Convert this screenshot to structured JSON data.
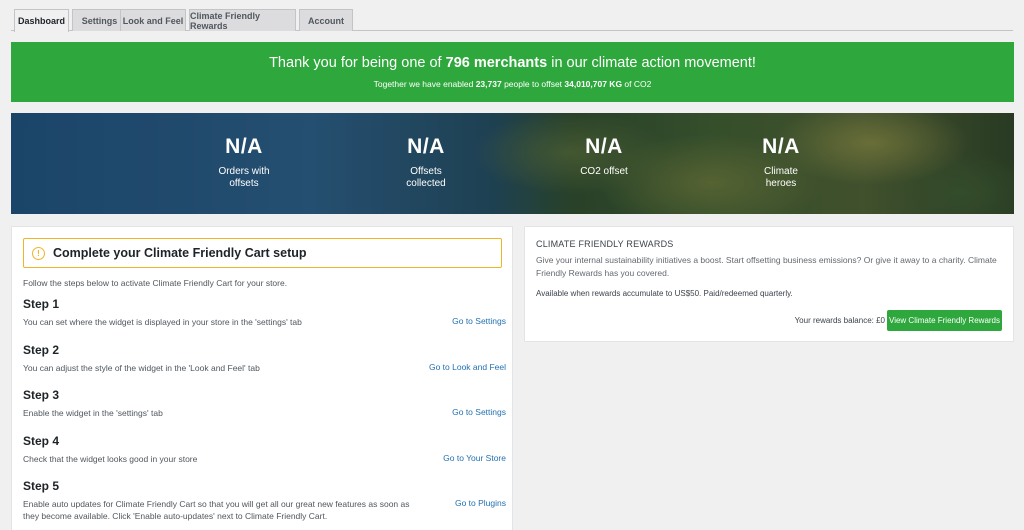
{
  "tabs": [
    {
      "label": "Dashboard",
      "active": true
    },
    {
      "label": "Settings"
    },
    {
      "label": "Look and Feel"
    },
    {
      "label": "Climate Friendly Rewards"
    },
    {
      "label": "Account"
    }
  ],
  "banner": {
    "prefix": "Thank you for being one of ",
    "count": "796 merchants",
    "suffix": " in our climate action movement!",
    "sub_prefix": "Together we have enabled ",
    "people": "23,737",
    "sub_mid": " people to offset ",
    "kg": "34,010,707 KG",
    "sub_suffix": " of CO2",
    "color": "#2ea83c"
  },
  "stats": [
    {
      "value": "N/A",
      "label_line1": "Orders with",
      "label_line2": "offsets"
    },
    {
      "value": "N/A",
      "label_line1": "Offsets",
      "label_line2": "collected"
    },
    {
      "value": "N/A",
      "label_line1": "CO2 offset",
      "label_line2": ""
    },
    {
      "value": "N/A",
      "label_line1": "Climate",
      "label_line2": "heroes"
    }
  ],
  "setup": {
    "title": "Complete your Climate Friendly Cart setup",
    "intro": "Follow the steps below to activate Climate Friendly Cart for your store.",
    "steps": [
      {
        "title": "Step 1",
        "desc": "You can set where the widget is displayed in your store in the 'settings' tab",
        "link": "Go to Settings"
      },
      {
        "title": "Step 2",
        "desc": "You can adjust the style of the widget in the 'Look and Feel' tab",
        "link": "Go to Look and Feel"
      },
      {
        "title": "Step 3",
        "desc": "Enable the widget in the 'settings' tab",
        "link": "Go to Settings"
      },
      {
        "title": "Step 4",
        "desc": "Check that the widget looks good in your store",
        "link": "Go to Your Store"
      },
      {
        "title": "Step 5",
        "desc": "Enable auto updates for Climate Friendly Cart so that you will get all our great new features as soon as they become available. Click 'Enable auto-updates' next to Climate Friendly Cart.",
        "link": "Go to Plugins"
      }
    ]
  },
  "rewards": {
    "title": "CLIMATE FRIENDLY REWARDS",
    "desc": "Give your internal sustainability initiatives a boost. Start offsetting business emissions? Or give it away to a charity. Climate Friendly Rewards has you covered.",
    "availability": "Available when rewards accumulate to US$50. Paid/redeemed quarterly.",
    "balance": "Your rewards balance: £0",
    "button": "View Climate Friendly Rewards"
  },
  "icons": {
    "setup_header": "info-icon"
  }
}
